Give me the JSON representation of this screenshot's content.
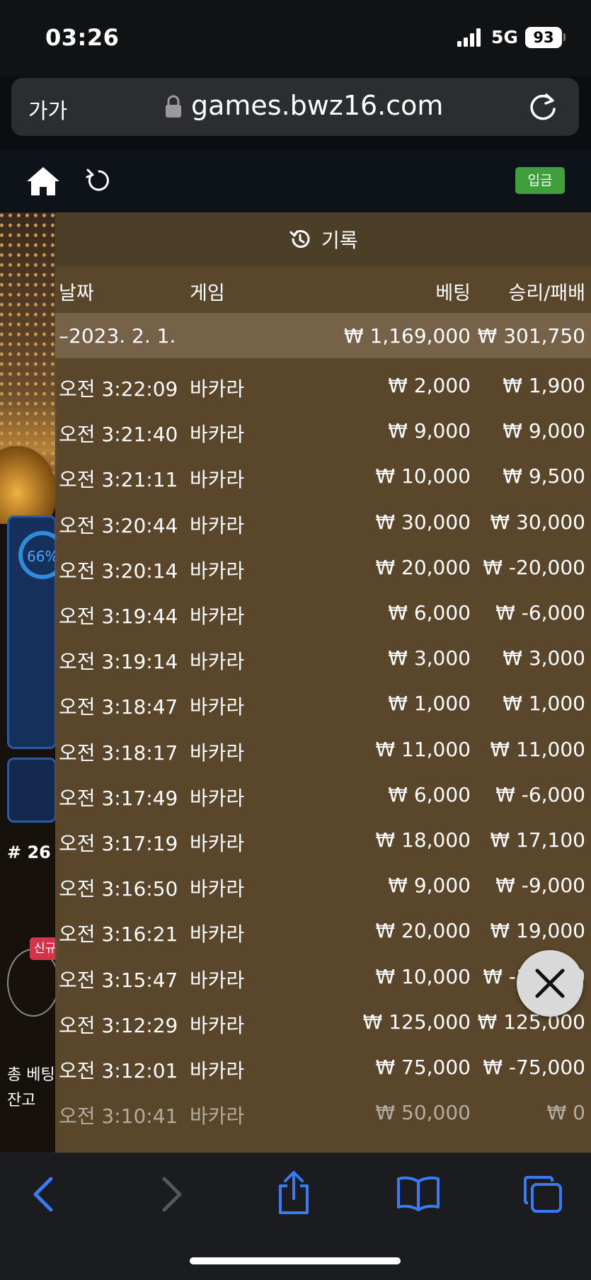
{
  "status": {
    "time": "03:26",
    "network": "5G",
    "battery": "93"
  },
  "browser": {
    "text_size": "가가",
    "url": "games.bwz16.com"
  },
  "nav": {
    "deposit_label": "입금"
  },
  "background": {
    "percent": "66%",
    "round": "# 26",
    "new_tag": "신규",
    "total_bet_label": "총 베팅",
    "balance_label": "잔고"
  },
  "history": {
    "title": "기록",
    "columns": {
      "date": "날짜",
      "game": "게임",
      "bet": "베팅",
      "win_loss": "승리/패배"
    },
    "summary": {
      "date": "–2023. 2. 1.",
      "bet": "₩ 1,169,000",
      "win_loss": "₩ 301,750"
    },
    "rows": [
      {
        "time": "오전 3:22:09",
        "game": "바카라",
        "bet": "₩ 2,000",
        "win_loss": "₩ 1,900"
      },
      {
        "time": "오전 3:21:40",
        "game": "바카라",
        "bet": "₩ 9,000",
        "win_loss": "₩ 9,000"
      },
      {
        "time": "오전 3:21:11",
        "game": "바카라",
        "bet": "₩ 10,000",
        "win_loss": "₩ 9,500"
      },
      {
        "time": "오전 3:20:44",
        "game": "바카라",
        "bet": "₩ 30,000",
        "win_loss": "₩ 30,000"
      },
      {
        "time": "오전 3:20:14",
        "game": "바카라",
        "bet": "₩ 20,000",
        "win_loss": "₩ -20,000"
      },
      {
        "time": "오전 3:19:44",
        "game": "바카라",
        "bet": "₩ 6,000",
        "win_loss": "₩ -6,000"
      },
      {
        "time": "오전 3:19:14",
        "game": "바카라",
        "bet": "₩ 3,000",
        "win_loss": "₩ 3,000"
      },
      {
        "time": "오전 3:18:47",
        "game": "바카라",
        "bet": "₩ 1,000",
        "win_loss": "₩ 1,000"
      },
      {
        "time": "오전 3:18:17",
        "game": "바카라",
        "bet": "₩ 11,000",
        "win_loss": "₩ 11,000"
      },
      {
        "time": "오전 3:17:49",
        "game": "바카라",
        "bet": "₩ 6,000",
        "win_loss": "₩ -6,000"
      },
      {
        "time": "오전 3:17:19",
        "game": "바카라",
        "bet": "₩ 18,000",
        "win_loss": "₩ 17,100"
      },
      {
        "time": "오전 3:16:50",
        "game": "바카라",
        "bet": "₩ 9,000",
        "win_loss": "₩ -9,000"
      },
      {
        "time": "오전 3:16:21",
        "game": "바카라",
        "bet": "₩ 20,000",
        "win_loss": "₩ 19,000"
      },
      {
        "time": "오전 3:15:47",
        "game": "바카라",
        "bet": "₩ 10,000",
        "win_loss": "₩ -10,000"
      },
      {
        "time": "오전 3:12:29",
        "game": "바카라",
        "bet": "₩ 125,000",
        "win_loss": "₩ 125,000"
      },
      {
        "time": "오전 3:12:01",
        "game": "바카라",
        "bet": "₩ 75,000",
        "win_loss": "₩ -75,000"
      },
      {
        "time": "오전 3:10:41",
        "game": "바카라",
        "bet": "₩ 50,000",
        "win_loss": "₩ 0"
      }
    ]
  },
  "colors": {
    "accent_green": "#3fa03b",
    "ios_blue": "#3a7bf5",
    "overlay_brown": "#5f4a2e"
  }
}
